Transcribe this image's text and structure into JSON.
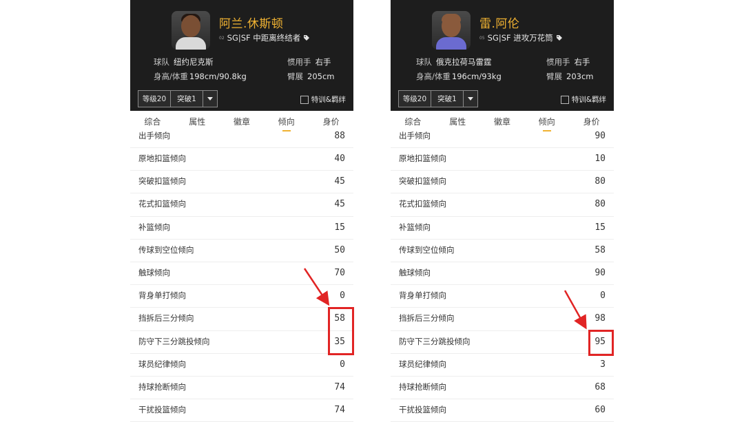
{
  "panels": [
    {
      "player_name": "阿兰.休斯顿",
      "jersey": "02",
      "position_desc": "SG|SF 中距离终结者",
      "team_label": "球队",
      "team": "纽约尼克斯",
      "hand_label": "惯用手",
      "hand": "右手",
      "hw_label": "身高/体重",
      "hw": "198cm/90.8kg",
      "wingspan_label": "臂展",
      "wingspan": "205cm",
      "level": "等级20",
      "breakthrough": "突破1",
      "training_label": "特训&羁绊",
      "tabs": [
        "综合",
        "属性",
        "徽章",
        "倾向",
        "身价"
      ],
      "active_tab": "倾向",
      "rows": [
        {
          "label": "出手倾向",
          "value": "88"
        },
        {
          "label": "原地扣篮倾向",
          "value": "40"
        },
        {
          "label": "突破扣篮倾向",
          "value": "45"
        },
        {
          "label": "花式扣篮倾向",
          "value": "45"
        },
        {
          "label": "补篮倾向",
          "value": "15"
        },
        {
          "label": "传球到空位倾向",
          "value": "50"
        },
        {
          "label": "触球倾向",
          "value": "70"
        },
        {
          "label": "背身单打倾向",
          "value": "0"
        },
        {
          "label": "挡拆后三分倾向",
          "value": "58"
        },
        {
          "label": "防守下三分跳投倾向",
          "value": "35"
        },
        {
          "label": "球员纪律倾向",
          "value": "0"
        },
        {
          "label": "持球抢断倾向",
          "value": "74"
        },
        {
          "label": "干扰投篮倾向",
          "value": "74"
        }
      ]
    },
    {
      "player_name": "雷.阿伦",
      "jersey": "05",
      "position_desc": "SG|SF 进攻万花筒",
      "team_label": "球队",
      "team": "俄克拉荷马雷霆",
      "hand_label": "惯用手",
      "hand": "右手",
      "hw_label": "身高/体重",
      "hw": "196cm/93kg",
      "wingspan_label": "臂展",
      "wingspan": "203cm",
      "level": "等级20",
      "breakthrough": "突破1",
      "training_label": "特训&羁绊",
      "tabs": [
        "综合",
        "属性",
        "徽章",
        "倾向",
        "身价"
      ],
      "active_tab": "倾向",
      "rows": [
        {
          "label": "出手倾向",
          "value": "90"
        },
        {
          "label": "原地扣篮倾向",
          "value": "10"
        },
        {
          "label": "突破扣篮倾向",
          "value": "80"
        },
        {
          "label": "花式扣篮倾向",
          "value": "80"
        },
        {
          "label": "补篮倾向",
          "value": "15"
        },
        {
          "label": "传球到空位倾向",
          "value": "58"
        },
        {
          "label": "触球倾向",
          "value": "90"
        },
        {
          "label": "背身单打倾向",
          "value": "0"
        },
        {
          "label": "挡拆后三分倾向",
          "value": "98"
        },
        {
          "label": "防守下三分跳投倾向",
          "value": "95"
        },
        {
          "label": "球员纪律倾向",
          "value": "3"
        },
        {
          "label": "持球抢断倾向",
          "value": "68"
        },
        {
          "label": "干扰投篮倾向",
          "value": "60"
        }
      ]
    }
  ],
  "colors": {
    "header_bg": "#1d1d1d",
    "name_gold": "#f0b232",
    "highlight_red": "#e12424"
  }
}
